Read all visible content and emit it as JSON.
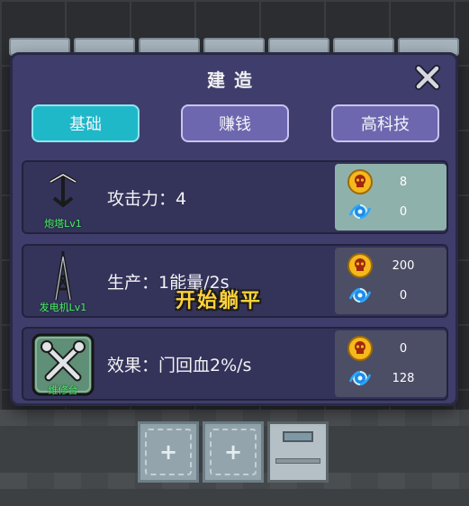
{
  "dialog": {
    "title": "建造",
    "close_icon": "close-icon"
  },
  "tabs": [
    {
      "label": "基础",
      "active": true
    },
    {
      "label": "赚钱",
      "active": false
    },
    {
      "label": "高科技",
      "active": false
    }
  ],
  "items": [
    {
      "icon": "turret-icon",
      "name": "炮塔Lv1",
      "desc": "攻击力：4",
      "cost_coin": "8",
      "cost_energy": "0",
      "highlight": true
    },
    {
      "icon": "generator-tower-icon",
      "name": "发电机Lv1",
      "desc": "生产：1能量/2s",
      "cost_coin": "200",
      "cost_energy": "0",
      "highlight": false
    },
    {
      "icon": "repair-wrench-icon",
      "name": "维修台",
      "desc": "效果：门回血2%/s",
      "cost_coin": "0",
      "cost_energy": "128",
      "highlight": false
    }
  ],
  "caption": "开始躺平",
  "colors": {
    "dialog_bg": "#3f3d6b",
    "tab_active": "#1fb8c9",
    "tab_inactive": "#6d67b0",
    "label_green": "#4bea6b",
    "caption_yellow": "#ffd23a"
  }
}
